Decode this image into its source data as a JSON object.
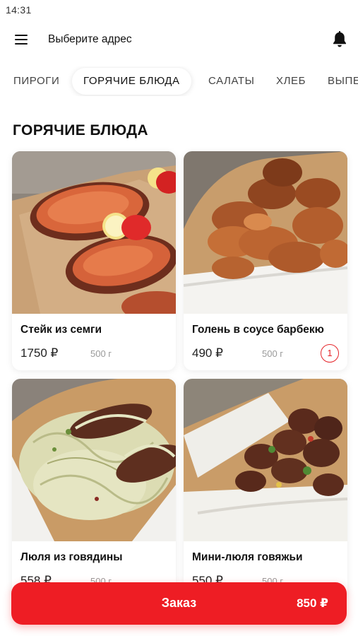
{
  "status_bar": {
    "time": "14:31"
  },
  "header": {
    "address_label": "Выберите адрес"
  },
  "tabs": [
    {
      "label": "ПИРОГИ",
      "active": false
    },
    {
      "label": "ГОРЯЧИЕ БЛЮДА",
      "active": true
    },
    {
      "label": "САЛАТЫ",
      "active": false
    },
    {
      "label": "ХЛЕБ",
      "active": false
    },
    {
      "label": "ВЫПЕЧКА",
      "active": false
    }
  ],
  "section": {
    "title": "ГОРЯЧИЕ БЛЮДА"
  },
  "products": [
    {
      "name": "Стейк из семги",
      "price": "1750 ₽",
      "weight": "500 г",
      "quantity": ""
    },
    {
      "name": "Голень в соусе барбекю",
      "price": "490 ₽",
      "weight": "500 г",
      "quantity": "1"
    },
    {
      "name": "Люля из говядины",
      "price": "558 ₽",
      "weight": "500 г",
      "quantity": ""
    },
    {
      "name": "Мини-люля говяжьи",
      "price": "550 ₽",
      "weight": "500 г",
      "quantity": ""
    }
  ],
  "order_bar": {
    "label": "Заказ",
    "total": "850 ₽"
  },
  "colors": {
    "accent": "#ee1d24",
    "badge": "#e5252a",
    "muted": "#9a9a9a",
    "background": "#ffffff"
  },
  "icons": {
    "menu": "hamburger-menu-icon",
    "notifications": "bell-icon"
  }
}
